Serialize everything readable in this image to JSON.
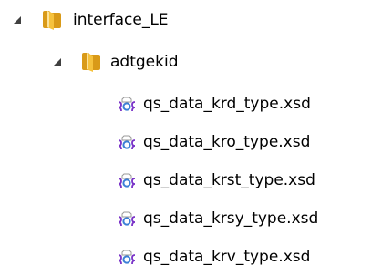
{
  "tree": {
    "root": {
      "label": "interface_LE",
      "icon": "folder-icon",
      "expanded": true,
      "children": [
        {
          "label": "adtgekid",
          "icon": "folder-icon",
          "expanded": true,
          "files": [
            {
              "label": "qs_data_krd_type.xsd",
              "icon": "xsd-file-icon"
            },
            {
              "label": "qs_data_kro_type.xsd",
              "icon": "xsd-file-icon"
            },
            {
              "label": "qs_data_krst_type.xsd",
              "icon": "xsd-file-icon"
            },
            {
              "label": "qs_data_krsy_type.xsd",
              "icon": "xsd-file-icon"
            },
            {
              "label": "qs_data_krv_type.xsd",
              "icon": "xsd-file-icon"
            }
          ]
        }
      ]
    }
  },
  "colors": {
    "expander": "#404040",
    "folder_back": "#d99a18",
    "folder_front": "#f6c23d",
    "folder_highlight": "#fde39a",
    "xsd_brace": "#7a33c8",
    "xsd_circle": "#3b7fd6",
    "xsd_page": "#ffffff"
  }
}
